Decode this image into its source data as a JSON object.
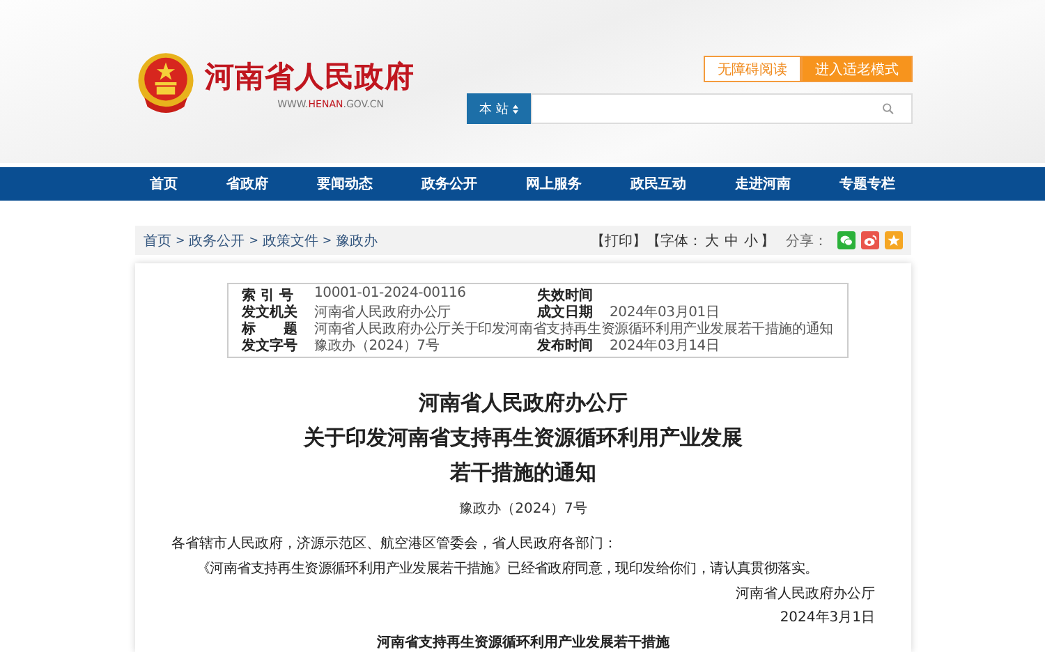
{
  "header": {
    "site_name": "河南省人民政府",
    "url_prefix": "WWW.",
    "url_highlight": "HENAN",
    "url_suffix": ".GOV.CN",
    "buttons": [
      {
        "label": "无障碍阅读",
        "kind": "outline"
      },
      {
        "label": "进入适老模式",
        "kind": "filled"
      }
    ],
    "search": {
      "scope": "本 站"
    }
  },
  "nav": [
    {
      "label": "首页"
    },
    {
      "label": "省政府"
    },
    {
      "label": "要闻动态"
    },
    {
      "label": "政务公开"
    },
    {
      "label": "网上服务"
    },
    {
      "label": "政民互动"
    },
    {
      "label": "走进河南"
    },
    {
      "label": "专题专栏"
    }
  ],
  "breadcrumb": {
    "separator": ">",
    "items": [
      "首页",
      "政务公开",
      "政策文件",
      "豫政办"
    ]
  },
  "tools": {
    "print": "【打印】",
    "font_open": "【字体：",
    "font_sizes": [
      "大",
      "中",
      "小"
    ],
    "font_close": "】",
    "share_label": "分享：",
    "share": [
      {
        "kind": "wechat"
      },
      {
        "kind": "weibo"
      },
      {
        "kind": "favorite"
      }
    ]
  },
  "meta": {
    "rows": [
      {
        "fields": [
          {
            "label": "索 引 号",
            "value": "10001-01-2024-00116"
          },
          {
            "label": "失效时间"
          }
        ]
      },
      {
        "fields": [
          {
            "label": "发文机关",
            "value": "河南省人民政府办公厅"
          },
          {
            "label": "成文日期",
            "value": "2024年03月01日"
          }
        ]
      },
      {
        "fields": [
          {
            "label": "标　　题",
            "value": "河南省人民政府办公厅关于印发河南省支持再生资源循环利用产业发展若干措施的通知"
          }
        ]
      },
      {
        "fields": [
          {
            "label": "发文字号",
            "value": "豫政办（2024）7号"
          },
          {
            "label": "发布时间",
            "value": "2024年03月14日"
          }
        ]
      }
    ]
  },
  "doc": {
    "title_lines": [
      "河南省人民政府办公厅",
      "关于印发河南省支持再生资源循环利用产业发展",
      "若干措施的通知"
    ],
    "number": "豫政办（2024）7号",
    "salutation": "各省辖市人民政府，济源示范区、航空港区管委会，省人民政府各部门：",
    "body": "《河南省支持再生资源循环利用产业发展若干措施》已经省政府同意，现印发给你们，请认真贯彻落实。",
    "signer": "河南省人民政府办公厅",
    "date": "2024年3月1日",
    "subtitle": "河南省支持再生资源循环利用产业发展若干措施"
  }
}
